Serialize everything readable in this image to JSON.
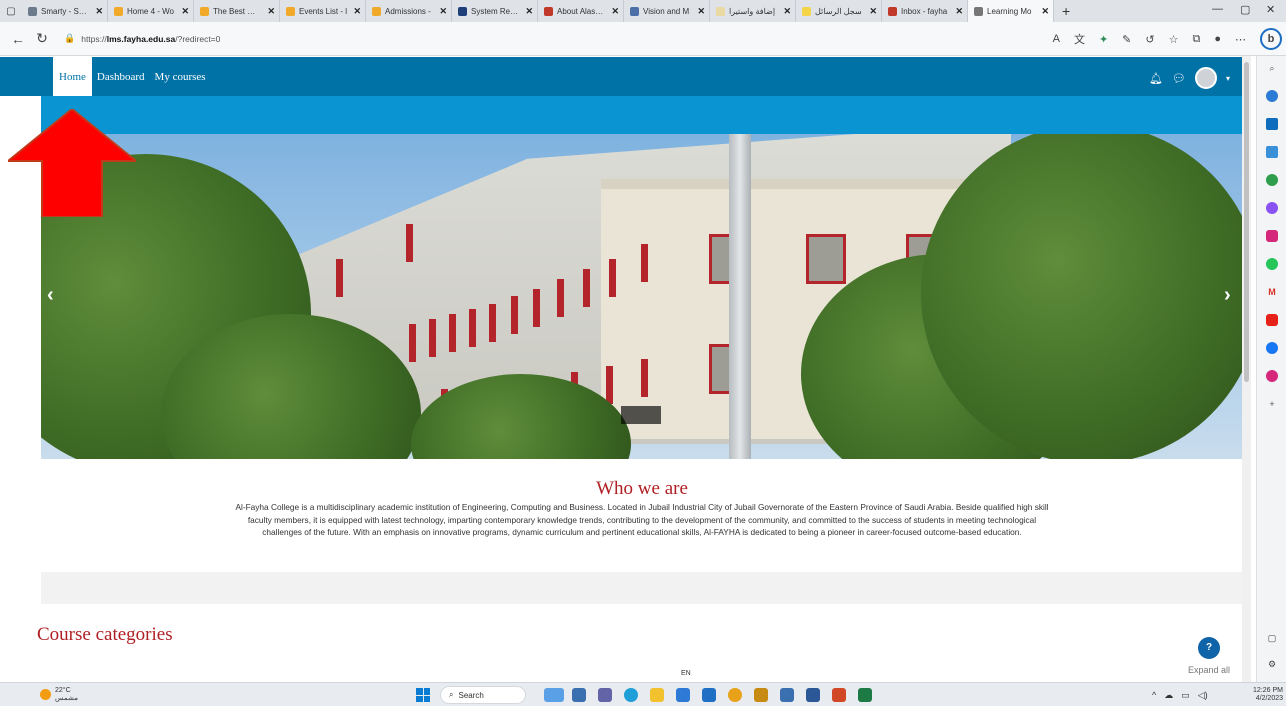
{
  "browser": {
    "tabs": [
      {
        "title": "Smarty - Scho",
        "color": "#6b7b8c"
      },
      {
        "title": "Home 4 - Wo",
        "color": "#f0a928"
      },
      {
        "title": "The Best Wor",
        "color": "#f0a928"
      },
      {
        "title": "Events List - l",
        "color": "#f0a928"
      },
      {
        "title": "Admissions -",
        "color": "#f0a928"
      },
      {
        "title": "System Recor",
        "color": "#1f3f7a"
      },
      {
        "title": "About Alasala",
        "color": "#c0392b"
      },
      {
        "title": "Vision and M",
        "color": "#4d6fa8"
      },
      {
        "title": "إضافة واستيرا",
        "color": "#e9d9a2"
      },
      {
        "title": "سجل الرسائل",
        "color": "#f5d547"
      },
      {
        "title": "Inbox - fayha",
        "color": "#c0392b"
      },
      {
        "title": "Learning Mo",
        "color": "#777777"
      }
    ],
    "new_tab": "+",
    "url_prefix": "https://",
    "url_host": "lms.fayha.edu.sa",
    "url_path": "/?redirect=0"
  },
  "navbar": {
    "items": [
      "Home",
      "Dashboard",
      "My courses"
    ]
  },
  "carousel": {
    "prev": "‹",
    "next": "›"
  },
  "about": {
    "title": "Who we are",
    "text": "Al-Fayha College is a multidisciplinary academic institution of Engineering, Computing and Business. Located in Jubail Industrial City of Jubail Governorate of the Eastern Province of Saudi Arabia. Beside qualified high skill faculty members, it is equipped with latest technology, imparting contemporary knowledge trends, contributing to the development of the community, and committed to the success of students in meeting technological challenges of the future. With an emphasis on innovative programs, dynamic curriculum and pertinent educational skills, Al-FAYHA is dedicated to being a pioneer in career-focused outcome-based education."
  },
  "courses": {
    "title": "Course categories",
    "expand_all": "Expand all"
  },
  "help_label": "?",
  "language": "EN",
  "taskbar": {
    "temperature": "22°C",
    "weather_desc": "مشمس",
    "search_label": "Search",
    "time": "12:26 PM",
    "date": "4/2/2023"
  },
  "colors": {
    "navbar": "#0172a6",
    "subbar": "#0a94d1",
    "heading": "#b01f24",
    "arrow": "#ff0000"
  }
}
